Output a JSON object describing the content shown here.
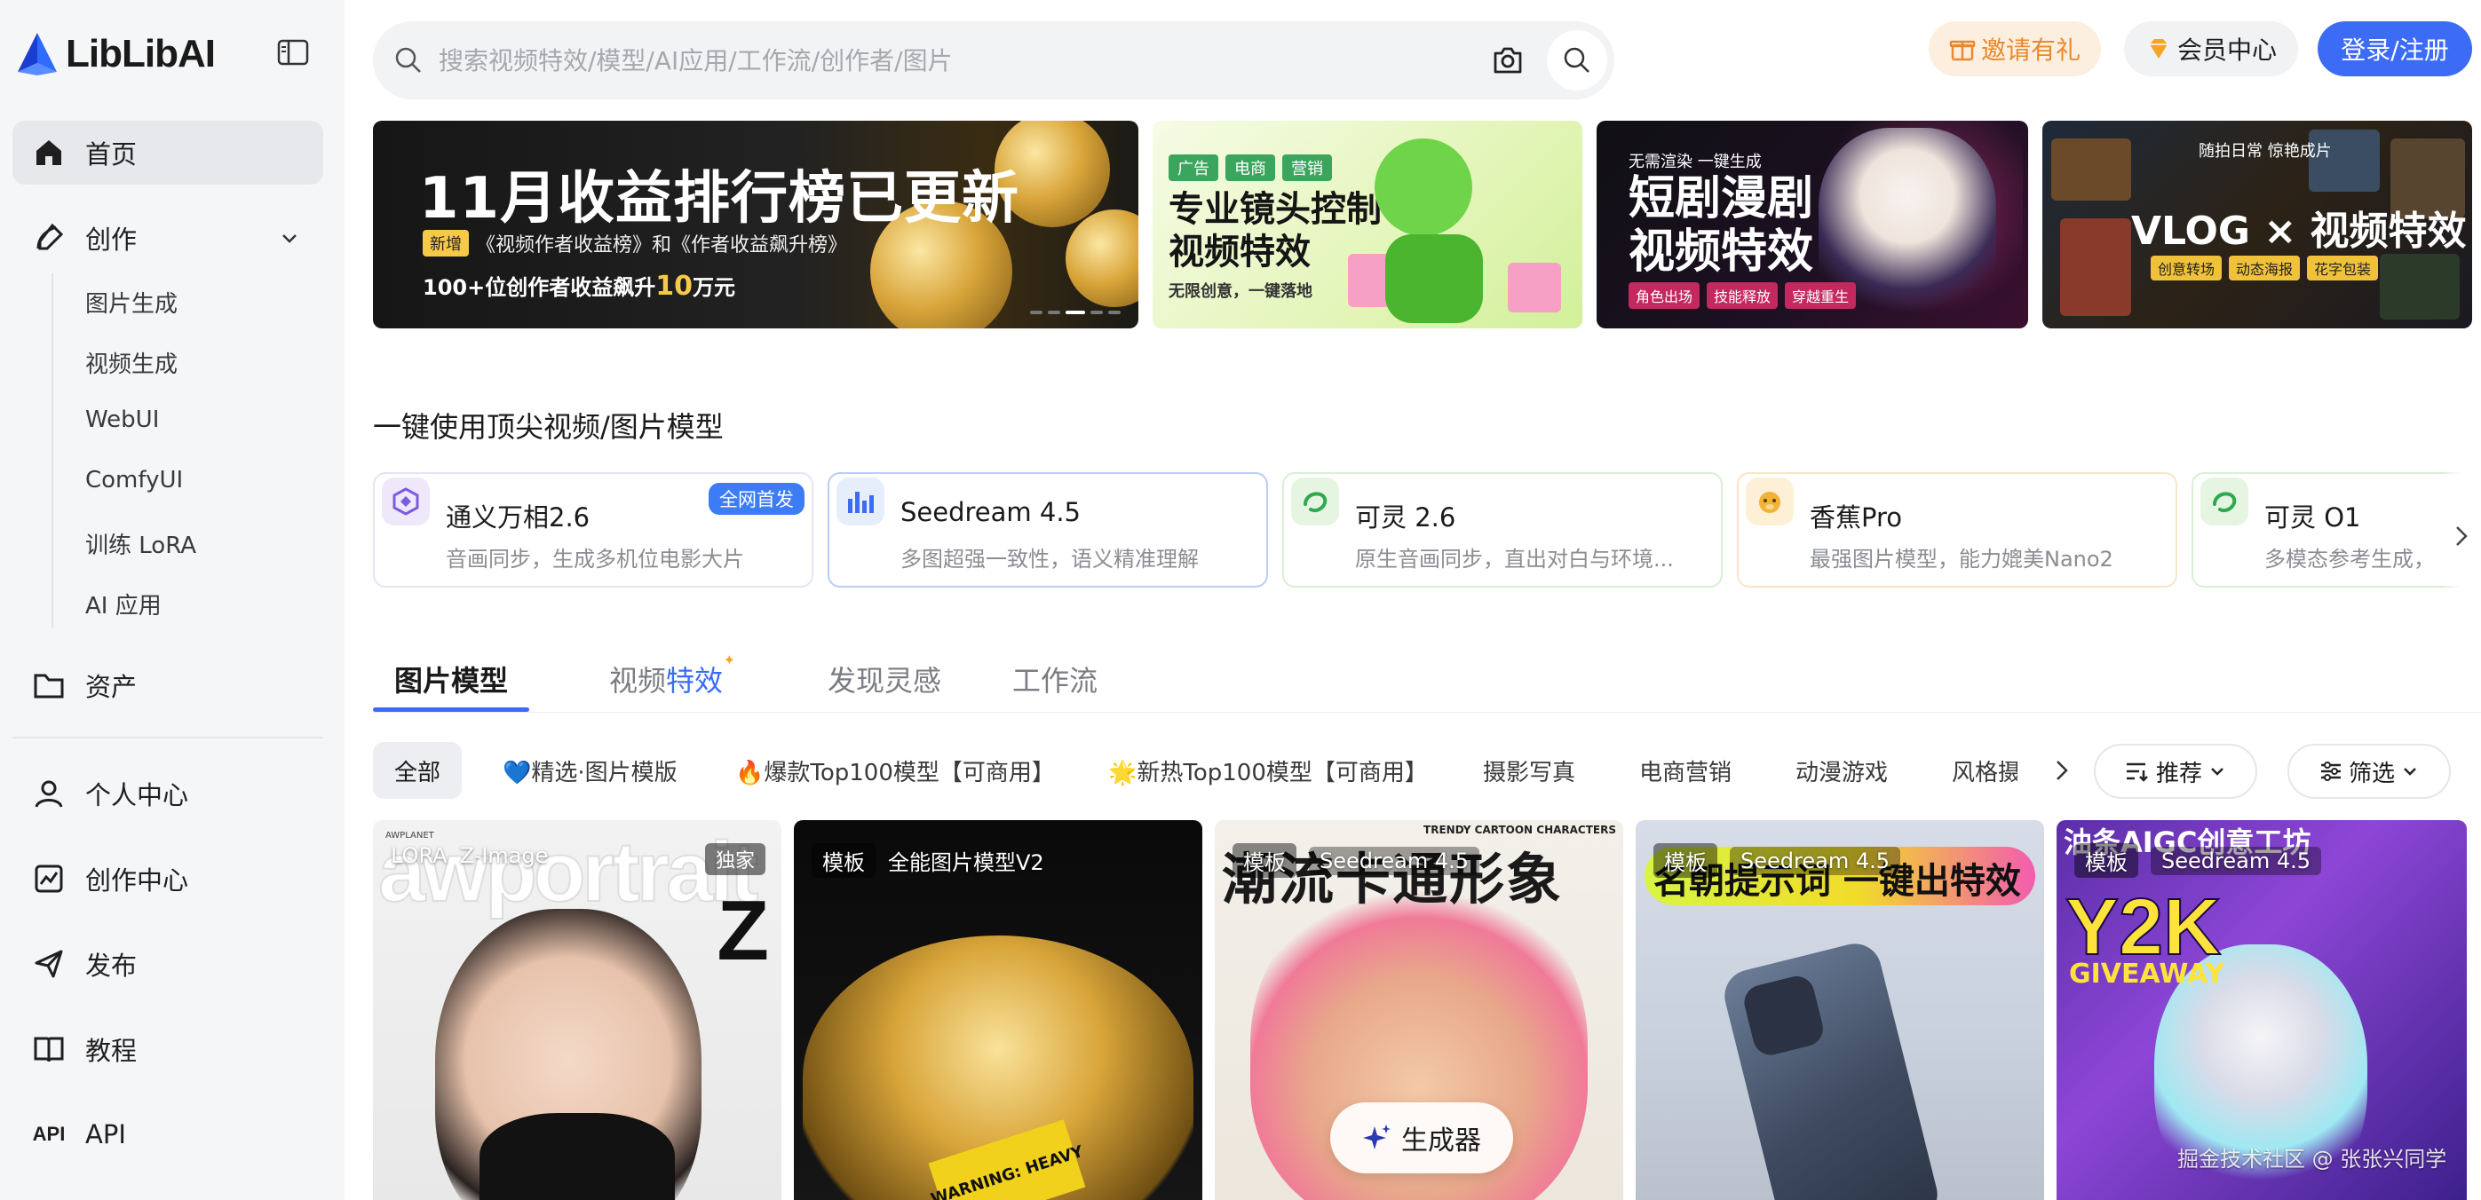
{
  "brand": {
    "logo_text": "LibLibAI"
  },
  "sidebar": {
    "items": [
      {
        "label": "首页",
        "icon": "home-icon",
        "active": true
      },
      {
        "label": "创作",
        "icon": "create-icon"
      },
      {
        "label": "资产",
        "icon": "folder-icon"
      },
      {
        "label": "个人中心",
        "icon": "user-icon"
      },
      {
        "label": "创作中心",
        "icon": "chart-icon"
      },
      {
        "label": "发布",
        "icon": "send-icon"
      },
      {
        "label": "教程",
        "icon": "book-icon"
      },
      {
        "label": "API",
        "icon": "api-icon"
      }
    ],
    "create_subitems": [
      "图片生成",
      "视频生成",
      "WebUI",
      "ComfyUI",
      "训练 LoRA",
      "AI 应用"
    ],
    "api_icon_text": "API"
  },
  "header": {
    "search_placeholder": "搜索视频特效/模型/AI应用/工作流/创作者/图片",
    "invite_label": "邀请有礼",
    "vip_label": "会员中心",
    "login_label": "登录/注册"
  },
  "banners": {
    "b1": {
      "title": "11月收益排行榜已更新",
      "tag": "新增",
      "subtitle": "《视频作者收益榜》和《作者收益飙升榜》",
      "line3_pre": "100+位创作者收益飙升",
      "line3_num": "10",
      "line3_post": "万元"
    },
    "b2": {
      "tags": [
        "广告",
        "电商",
        "营销"
      ],
      "title_line1": "专业镜头控制",
      "title_line2": "视频特效",
      "subtitle": "无限创意，一键落地"
    },
    "b3": {
      "top": "无需渲染 一键生成",
      "title_line1": "短剧漫剧",
      "title_line2": "视频特效",
      "tags": [
        "角色出场",
        "技能释放",
        "穿越重生"
      ]
    },
    "b4": {
      "top": "随拍日常 惊艳成片",
      "title": "VLOG × 视频特效",
      "tags": [
        "创意转场",
        "动态海报",
        "花字包装"
      ]
    }
  },
  "models_section": {
    "title": "一键使用顶尖视频/图片模型",
    "cards": [
      {
        "name": "通义万相2.6",
        "desc": "音画同步，生成多机位电影大片",
        "badge": "全网首发",
        "icon": "tongyi-icon",
        "color": "#efe8fb"
      },
      {
        "name": "Seedream 4.5",
        "desc": "多图超强一致性，语义精准理解",
        "icon": "seedream-icon",
        "color": "#e6eefc"
      },
      {
        "name": "可灵 2.6",
        "desc": "原生音画同步，直出对白与环境...",
        "icon": "kling-icon",
        "color": "#e5f5e2"
      },
      {
        "name": "香蕉Pro",
        "desc": "最强图片模型，能力媲美Nano2",
        "icon": "banana-icon",
        "color": "#fdf0d7"
      },
      {
        "name": "可灵 O1",
        "desc": "多模态参考生成，",
        "icon": "kling-icon",
        "color": "#e5f5e2"
      }
    ]
  },
  "tabs": [
    {
      "label": "图片模型",
      "active": true
    },
    {
      "label_pre": "视频",
      "label_hl": "特效",
      "spark": "✦"
    },
    {
      "label": "发现灵感"
    },
    {
      "label": "工作流"
    }
  ],
  "filters": {
    "chips": [
      "全部",
      "💙精选·图片模版",
      "🔥爆款Top100模型【可商用】",
      "🌟新热Top100模型【可商用】",
      "摄影写真",
      "电商营销",
      "动漫游戏",
      "风格摄"
    ],
    "sort_label": "推荐",
    "filter_label": "筛选"
  },
  "gallery": [
    {
      "type": "LORA",
      "model": "Z-Image",
      "exclusive": "独家",
      "big_text": "awportrait",
      "letter": "Z",
      "brand": "AWPLANET"
    },
    {
      "type": "模板",
      "model": "全能图片模型V2",
      "warning_line1": "WARNING:",
      "warning_line2": "HEAVY"
    },
    {
      "type": "模板",
      "model": "Seedream 4.5",
      "title": "潮流卡通形象",
      "en": "TRENDY CARTOON CHARACTERS",
      "gen_button": "生成器"
    },
    {
      "type": "模板",
      "model": "Seedream 4.5",
      "band_text": "名朝提示词 一键出特效"
    },
    {
      "type": "模板",
      "model": "Seedream 4.5",
      "title": "油条AIGC创意工坊",
      "y2k": "Y2K",
      "give": "GIVEAWAY"
    }
  ],
  "watermark": "掘金技术社区 @ 张张兴同学",
  "colors": {
    "accent": "#3c6cf6",
    "invite": "#e8892f",
    "badge": "#3c7df6"
  }
}
